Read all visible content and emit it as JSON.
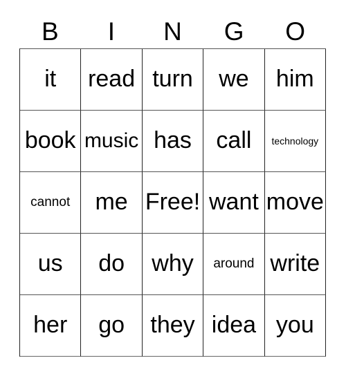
{
  "card": {
    "headers": [
      "B",
      "I",
      "N",
      "G",
      "O"
    ],
    "rows": [
      [
        {
          "text": "it",
          "size": "lg"
        },
        {
          "text": "read",
          "size": "lg"
        },
        {
          "text": "turn",
          "size": "lg"
        },
        {
          "text": "we",
          "size": "lg"
        },
        {
          "text": "him",
          "size": "lg"
        }
      ],
      [
        {
          "text": "book",
          "size": "lg"
        },
        {
          "text": "music",
          "size": "md"
        },
        {
          "text": "has",
          "size": "lg"
        },
        {
          "text": "call",
          "size": "lg"
        },
        {
          "text": "technology",
          "size": "xs"
        }
      ],
      [
        {
          "text": "cannot",
          "size": "sm"
        },
        {
          "text": "me",
          "size": "lg"
        },
        {
          "text": "Free!",
          "size": "lg"
        },
        {
          "text": "want",
          "size": "lg"
        },
        {
          "text": "move",
          "size": "lg"
        }
      ],
      [
        {
          "text": "us",
          "size": "lg"
        },
        {
          "text": "do",
          "size": "lg"
        },
        {
          "text": "why",
          "size": "lg"
        },
        {
          "text": "around",
          "size": "sm"
        },
        {
          "text": "write",
          "size": "lg"
        }
      ],
      [
        {
          "text": "her",
          "size": "lg"
        },
        {
          "text": "go",
          "size": "lg"
        },
        {
          "text": "they",
          "size": "lg"
        },
        {
          "text": "idea",
          "size": "lg"
        },
        {
          "text": "you",
          "size": "lg"
        }
      ]
    ],
    "free_space": "Free!",
    "colors": {
      "background": "#ffffff",
      "text": "#000000",
      "grid_line": "#222222",
      "grid_line_light": "#555555"
    }
  }
}
